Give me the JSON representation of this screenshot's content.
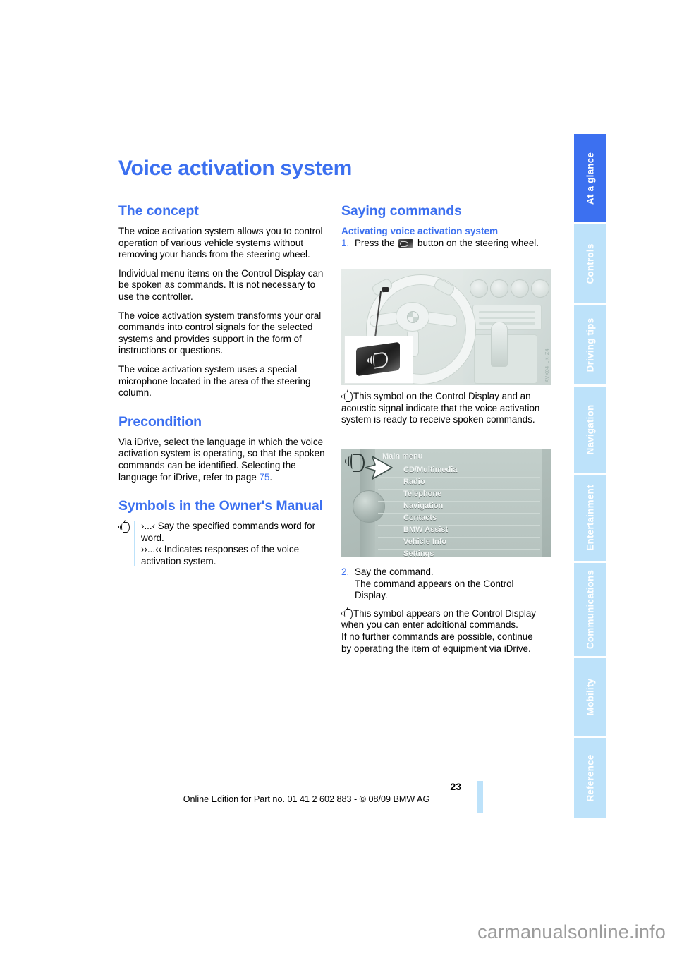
{
  "page": {
    "title": "Voice activation system",
    "number": "23",
    "edition_line": "Online Edition for Part no. 01 41 2 602 883 - © 08/09 BMW AG",
    "watermark": "carmanualsonline.info"
  },
  "colors": {
    "accent": "#3c70f0",
    "tab_inactive": "#bde2fa",
    "tab_active": "#3c70f0",
    "text": "#000000"
  },
  "sidebar": {
    "items": [
      {
        "label": "At a glance",
        "active": true
      },
      {
        "label": "Controls",
        "active": false
      },
      {
        "label": "Driving tips",
        "active": false
      },
      {
        "label": "Navigation",
        "active": false
      },
      {
        "label": "Entertainment",
        "active": false
      },
      {
        "label": "Communications",
        "active": false
      },
      {
        "label": "Mobility",
        "active": false
      },
      {
        "label": "Reference",
        "active": false
      }
    ]
  },
  "left_column": {
    "heading": "The concept",
    "paragraphs": [
      "The voice activation system allows you to control operation of various vehicle systems without removing your hands from the steering wheel.",
      "Individual menu items on the Control Display can be spoken as commands. It is not necessary to use the controller.",
      "The voice activation system transforms your oral commands into control signals for the selected systems and provides support in the form of instructions or questions.",
      "The voice activation system uses a special microphone located in the area of the steering column."
    ],
    "precondition": {
      "heading": "Precondition",
      "text_before": "Via iDrive, select the language in which the voice activation system is operating, so that the spoken commands can be identified. Selecting the language for iDrive, refer to page ",
      "page_ref": "75",
      "text_after": "."
    },
    "symbols": {
      "heading": "Symbols in the Owner's Manual",
      "line1": "›...‹ Say the specified commands word for word.",
      "line2": "››...‹‹ Indicates responses of the voice activation system.",
      "icon": "voice-activation-symbol"
    }
  },
  "right_column": {
    "heading": "Saying commands",
    "subheading": "Activating voice activation system",
    "step1": {
      "number": "1.",
      "text_before": "Press the ",
      "text_after": " button on the steering wheel.",
      "button_icon": "voice-button-chip"
    },
    "figure1": {
      "name": "cockpit-steering-wheel-photo",
      "code": "AVX04-LK-Z4"
    },
    "note1": "This symbol on the Control Display and an acoustic signal indicate that the voice activation system is ready to receive spoken commands.",
    "figure2": {
      "name": "idrive-main-menu-screenshot",
      "title": "Main menu",
      "items": [
        "CD/Multimedia",
        "Radio",
        "Telephone",
        "Navigation",
        "Contacts",
        "BMW Assist",
        "Vehicle Info",
        "Settings"
      ]
    },
    "step2": {
      "number": "2.",
      "line1": "Say the command.",
      "line2": "The command appears on the Control",
      "line3": "Display."
    },
    "note2_line1": "This symbol appears on the Control Display",
    "note2_line2": "when you can enter additional commands.",
    "note2_line3": "If no further commands are possible, continue",
    "note2_line4": "by operating the item of equipment via iDrive."
  }
}
